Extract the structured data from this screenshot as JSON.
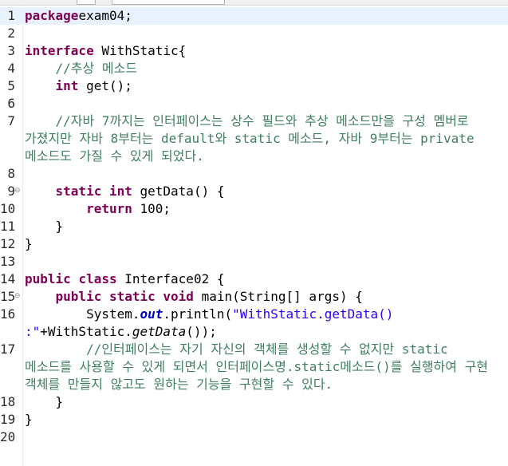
{
  "lines": [
    {
      "n": "1",
      "parts": [
        [
          "kw",
          "package"
        ],
        [
          "",
          "exam04;"
        ]
      ]
    },
    {
      "n": "2",
      "parts": []
    },
    {
      "n": "3",
      "parts": [
        [
          "kw",
          "interface"
        ],
        [
          "",
          " WithStatic{"
        ]
      ]
    },
    {
      "n": "4",
      "parts": [
        [
          "",
          "    "
        ],
        [
          "cm",
          "//추상 메소드"
        ]
      ]
    },
    {
      "n": "5",
      "parts": [
        [
          "",
          "    "
        ],
        [
          "kw",
          "int"
        ],
        [
          "",
          " get();"
        ]
      ]
    },
    {
      "n": "6",
      "parts": []
    },
    {
      "n": "7",
      "parts": [
        [
          "",
          "    "
        ],
        [
          "cm",
          "//자바 7까지는 인터페이스는 상수 필드와 추상 메소드만을 구성 멤버로"
        ]
      ]
    },
    {
      "n": "",
      "parts": [
        [
          "cm",
          "가졌지만 자바 8부터는 default와 static 메소드, 자바 9부터는 private"
        ]
      ]
    },
    {
      "n": "",
      "parts": [
        [
          "cm",
          "메소드도 가질 수 있게 되었다."
        ]
      ]
    },
    {
      "n": "8",
      "parts": []
    },
    {
      "n": "9",
      "fold": true,
      "parts": [
        [
          "",
          "    "
        ],
        [
          "kw",
          "static"
        ],
        [
          "",
          " "
        ],
        [
          "kw",
          "int"
        ],
        [
          "",
          " getData() {"
        ]
      ]
    },
    {
      "n": "10",
      "parts": [
        [
          "",
          "        "
        ],
        [
          "kw",
          "return"
        ],
        [
          "",
          " 100;"
        ]
      ]
    },
    {
      "n": "11",
      "parts": [
        [
          "",
          "    }"
        ]
      ]
    },
    {
      "n": "12",
      "parts": [
        [
          "",
          "}"
        ]
      ]
    },
    {
      "n": "13",
      "parts": []
    },
    {
      "n": "14",
      "parts": [
        [
          "kw",
          "public"
        ],
        [
          "",
          " "
        ],
        [
          "kw",
          "class"
        ],
        [
          "",
          " Interface02 {"
        ]
      ]
    },
    {
      "n": "15",
      "fold": true,
      "parts": [
        [
          "",
          "    "
        ],
        [
          "kw",
          "public"
        ],
        [
          "",
          " "
        ],
        [
          "kw",
          "static"
        ],
        [
          "",
          " "
        ],
        [
          "kw",
          "void"
        ],
        [
          "",
          " main(String[] args) {"
        ]
      ]
    },
    {
      "n": "16",
      "parts": [
        [
          "",
          "        System."
        ],
        [
          "fld",
          "out"
        ],
        [
          "",
          ".println("
        ],
        [
          "str",
          "\"WithStatic.getData()"
        ]
      ]
    },
    {
      "n": "",
      "parts": [
        [
          "str",
          ":\""
        ],
        [
          "",
          "+WithStatic."
        ],
        [
          "it",
          "getData"
        ],
        [
          "",
          "());"
        ]
      ]
    },
    {
      "n": "17",
      "parts": [
        [
          "",
          "        "
        ],
        [
          "cm",
          "//인터페이스는 자기 자신의 객체를 생성할 수 없지만 static"
        ]
      ]
    },
    {
      "n": "",
      "parts": [
        [
          "cm",
          "메소드를 사용할 수 있게 되면서 인터페이스명.static메소드()를 실행하여 구현"
        ]
      ]
    },
    {
      "n": "",
      "parts": [
        [
          "cm",
          "객체를 만들지 않고도 원하는 기능을 구현할 수 있다."
        ]
      ]
    },
    {
      "n": "18",
      "parts": [
        [
          "",
          "    }"
        ]
      ]
    },
    {
      "n": "19",
      "parts": [
        [
          "",
          "}"
        ]
      ]
    },
    {
      "n": "20",
      "parts": []
    }
  ],
  "current_line_index": 0,
  "icons": {
    "fold": "fold-minus-icon"
  }
}
